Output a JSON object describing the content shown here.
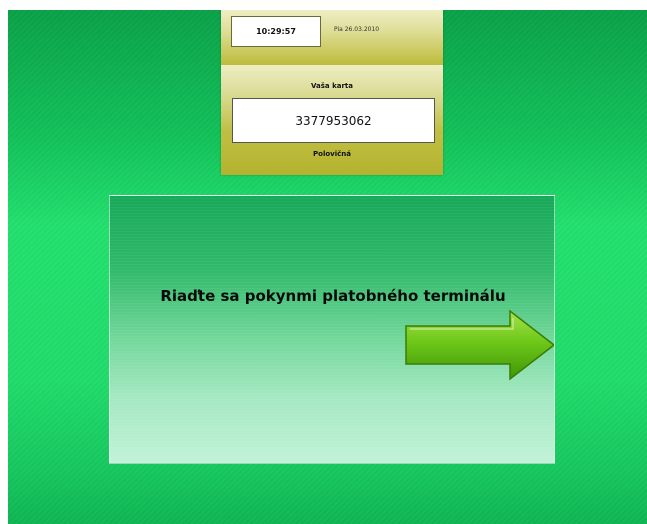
{
  "header": {
    "time": "10:29:57",
    "date": "Pia 26.03.2010"
  },
  "card": {
    "label": "Vaša karta",
    "number": "3377953062",
    "fare_type": "Polovičná"
  },
  "message": {
    "text": "Riaďte sa pokynmi platobného terminálu",
    "icon": "arrow-right-icon"
  },
  "colors": {
    "background": "#20dc6b",
    "panel": "#c8c74e",
    "arrow": "#5dba12"
  }
}
